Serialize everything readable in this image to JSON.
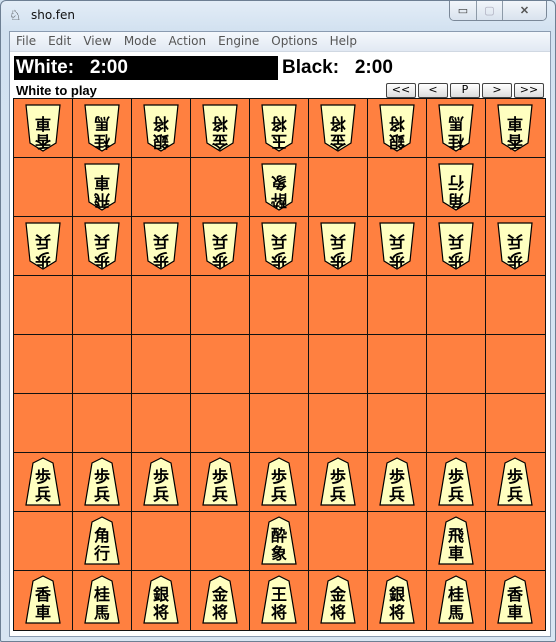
{
  "window": {
    "title": "sho.fen",
    "icon": "knight-icon",
    "controls": {
      "minimize": "▭",
      "maximize": "▢",
      "close": "✕"
    }
  },
  "menu": [
    "File",
    "Edit",
    "View",
    "Mode",
    "Action",
    "Engine",
    "Options",
    "Help"
  ],
  "clocks": {
    "white": "White:   2:00",
    "black": "Black:   2:00",
    "active": "white"
  },
  "status": "White to play",
  "nav_buttons": [
    "<<",
    "<",
    "P",
    ">",
    ">>"
  ],
  "colors": {
    "board": "#ff8040",
    "piece_face": "#ffffc0",
    "grid": "#111111",
    "active_clock_bg": "#000000"
  },
  "board": {
    "rows": [
      [
        {
          "s": "white",
          "t": "香車"
        },
        {
          "s": "white",
          "t": "桂馬"
        },
        {
          "s": "white",
          "t": "銀将"
        },
        {
          "s": "white",
          "t": "金将"
        },
        {
          "s": "white",
          "t": "玉将"
        },
        {
          "s": "white",
          "t": "金将"
        },
        {
          "s": "white",
          "t": "銀将"
        },
        {
          "s": "white",
          "t": "桂馬"
        },
        {
          "s": "white",
          "t": "香車"
        }
      ],
      [
        null,
        {
          "s": "white",
          "t": "飛車"
        },
        null,
        null,
        {
          "s": "white",
          "t": "酔象"
        },
        null,
        null,
        {
          "s": "white",
          "t": "角行"
        },
        null
      ],
      [
        {
          "s": "white",
          "t": "歩兵"
        },
        {
          "s": "white",
          "t": "歩兵"
        },
        {
          "s": "white",
          "t": "歩兵"
        },
        {
          "s": "white",
          "t": "歩兵"
        },
        {
          "s": "white",
          "t": "歩兵"
        },
        {
          "s": "white",
          "t": "歩兵"
        },
        {
          "s": "white",
          "t": "歩兵"
        },
        {
          "s": "white",
          "t": "歩兵"
        },
        {
          "s": "white",
          "t": "歩兵"
        }
      ],
      [
        null,
        null,
        null,
        null,
        null,
        null,
        null,
        null,
        null
      ],
      [
        null,
        null,
        null,
        null,
        null,
        null,
        null,
        null,
        null
      ],
      [
        null,
        null,
        null,
        null,
        null,
        null,
        null,
        null,
        null
      ],
      [
        {
          "s": "black",
          "t": "歩兵"
        },
        {
          "s": "black",
          "t": "歩兵"
        },
        {
          "s": "black",
          "t": "歩兵"
        },
        {
          "s": "black",
          "t": "歩兵"
        },
        {
          "s": "black",
          "t": "歩兵"
        },
        {
          "s": "black",
          "t": "歩兵"
        },
        {
          "s": "black",
          "t": "歩兵"
        },
        {
          "s": "black",
          "t": "歩兵"
        },
        {
          "s": "black",
          "t": "歩兵"
        }
      ],
      [
        null,
        {
          "s": "black",
          "t": "角行"
        },
        null,
        null,
        {
          "s": "black",
          "t": "酔象"
        },
        null,
        null,
        {
          "s": "black",
          "t": "飛車"
        },
        null
      ],
      [
        {
          "s": "black",
          "t": "香車"
        },
        {
          "s": "black",
          "t": "桂馬"
        },
        {
          "s": "black",
          "t": "銀将"
        },
        {
          "s": "black",
          "t": "金将"
        },
        {
          "s": "black",
          "t": "王将"
        },
        {
          "s": "black",
          "t": "金将"
        },
        {
          "s": "black",
          "t": "銀将"
        },
        {
          "s": "black",
          "t": "桂馬"
        },
        {
          "s": "black",
          "t": "香車"
        }
      ]
    ]
  }
}
